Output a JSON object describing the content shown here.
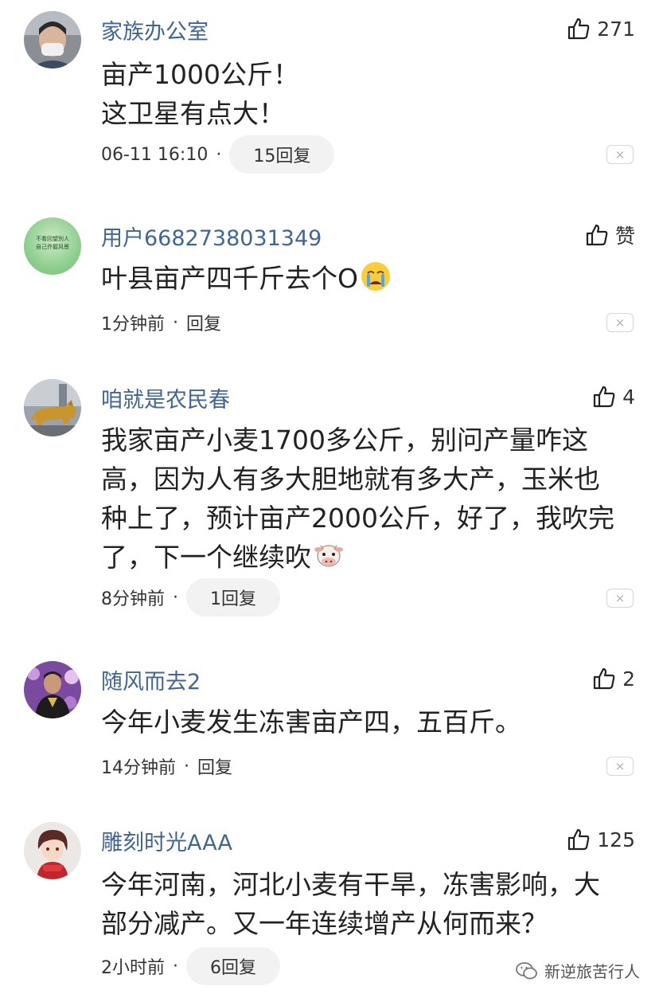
{
  "comments": [
    {
      "username": "家族办公室",
      "likes": "271",
      "lines": [
        "亩产1000公斤！",
        "这卫星有点大！"
      ],
      "time": "06-11 16:10",
      "reply": "15回复"
    },
    {
      "username": "用户6682738031349",
      "likes": "赞",
      "lines": [
        "叶县亩产四千斤去个O"
      ],
      "time": "1分钟前",
      "reply": "回复",
      "avatar_text": [
        "不看回望別人",
        "自己乔握风景"
      ]
    },
    {
      "username": "咱就是农民春",
      "likes": "4",
      "lines": [
        "我家亩产小麦1700多公斤，别问产量咋这",
        "高，因为人有多大胆地就有多大产，玉米也",
        "种上了，预计亩产2000公斤，好了，我吹完",
        "了，下一个继续吹"
      ],
      "time": "8分钟前",
      "reply": "1回复"
    },
    {
      "username": "随风而去2",
      "likes": "2",
      "lines": [
        "今年小麦发生冻害亩产四，五百斤。"
      ],
      "time": "14分钟前",
      "reply": "回复"
    },
    {
      "username": "雕刻时光AAA",
      "likes": "125",
      "lines": [
        "今年河南，河北小麦有干旱，冻害影响，大",
        "部分减产。又一年连续增产从何而来？"
      ],
      "time": "2小时前",
      "reply": "6回复"
    }
  ],
  "dot": "·",
  "close_symbol": "×",
  "watermark": "新逆旅苦行人",
  "colors": {
    "username": "#406599",
    "pill": "#f2f2f2",
    "text": "#222222"
  }
}
